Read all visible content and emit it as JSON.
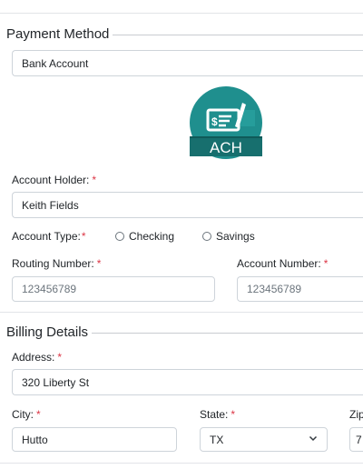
{
  "payment": {
    "legend": "Payment Method",
    "method_value": "Bank Account",
    "logo_text": "ACH",
    "account_holder_label": "Account Holder:",
    "account_holder_value": "Keith Fields",
    "account_type_label": "Account Type:",
    "account_type_options": [
      "Checking",
      "Savings"
    ],
    "routing_label": "Routing Number:",
    "routing_placeholder": "123456789",
    "account_number_label": "Account Number:",
    "account_number_placeholder": "123456789"
  },
  "billing": {
    "legend": "Billing Details",
    "address_label": "Address:",
    "address_value": "320 Liberty St",
    "city_label": "City:",
    "city_value": "Hutto",
    "state_label": "State:",
    "state_value": "TX",
    "zip_label_partial": "Zip",
    "zip_value_partial": "7"
  },
  "required_marker": "*",
  "colors": {
    "ach_teal": "#1f8f8e",
    "ach_dark": "#176f6e",
    "required": "#dc3545",
    "border": "#ced4da"
  }
}
